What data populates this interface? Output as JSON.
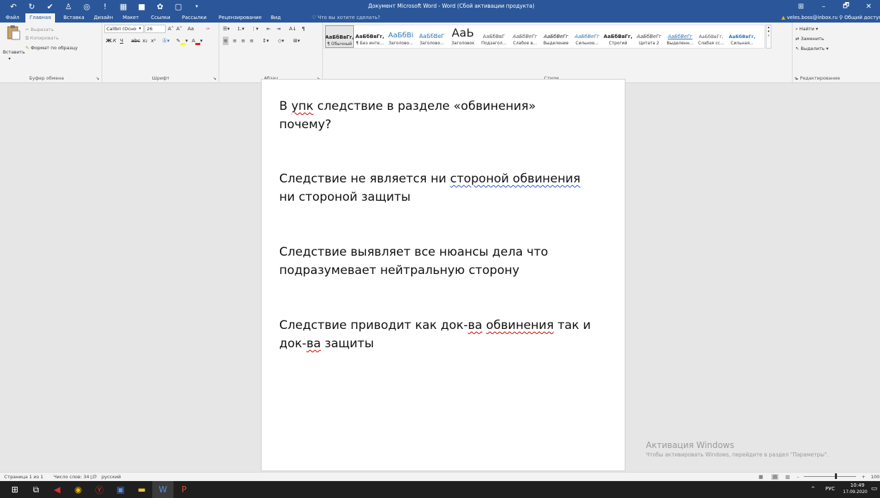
{
  "window": {
    "title": "Документ Microsoft Word - Word (Сбой активации продукта)",
    "qat_icons": [
      "undo-icon",
      "redo-icon",
      "vk-icon",
      "ok-icon",
      "opera-icon",
      "alert-icon",
      "grid-icon",
      "square-icon",
      "bug-icon",
      "new-doc-icon"
    ],
    "controls": [
      "⊞",
      "–",
      "🗗",
      "✕"
    ]
  },
  "tabs": [
    "Файл",
    "Главная",
    "Вставка",
    "Дизайн",
    "Макет",
    "Ссылки",
    "Рассылки",
    "Рецензирование",
    "Вид"
  ],
  "active_tab": "Главная",
  "tell_me": "Что вы хотите сделать?",
  "account": "veles.boss@inbox.ru",
  "share": "Общий доступ",
  "clipboard": {
    "paste": "Вставить",
    "cut": "Вырезать",
    "copy": "Копировать",
    "format_painter": "Формат по образцу",
    "label": "Буфер обмена"
  },
  "font": {
    "name": "Calibri (Осно",
    "size": "26",
    "bold": "Ж",
    "italic": "К",
    "underline": "Ч",
    "strike": "abc",
    "sub": "x₂",
    "sup": "x²",
    "grow": "A˄",
    "shrink": "A˅",
    "case": "Aa",
    "label": "Шрифт"
  },
  "paragraph": {
    "sort": "А↓",
    "pilcrow": "¶",
    "label": "Абзац"
  },
  "styles": {
    "label": "Стили",
    "items": [
      {
        "preview": "АаБбВвГг,",
        "name": "¶ Обычный"
      },
      {
        "preview": "АаБбВвГг,",
        "name": "¶ Без инте..."
      },
      {
        "preview": "АаБбВі",
        "name": "Заголово..."
      },
      {
        "preview": "АаБбВеГ",
        "name": "Заголово..."
      },
      {
        "preview": "АаЬ",
        "name": "Заголовок"
      },
      {
        "preview": "АаБбВвГ",
        "name": "Подзагол..."
      },
      {
        "preview": "АаБбВеГг",
        "name": "Слабое в..."
      },
      {
        "preview": "АаБбВеГг",
        "name": "Выделение"
      },
      {
        "preview": "АаБбВеГг",
        "name": "Сильное..."
      },
      {
        "preview": "АаБбВвГг,",
        "name": "Строгий"
      },
      {
        "preview": "АаБбВеГг",
        "name": "Цитата 2"
      },
      {
        "preview": "АаБбВеГг",
        "name": "Выделенн..."
      },
      {
        "preview": "АаБбВвГг,",
        "name": "Слабая сс..."
      },
      {
        "preview": "АаБбВвГг,",
        "name": "Сильная..."
      }
    ]
  },
  "editing": {
    "find": "Найти",
    "replace": "Заменить",
    "select": "Выделить",
    "label": "Редактирование"
  },
  "document": {
    "p1_a": "В ",
    "p1_err": "упк",
    "p1_b": " следствие в разделе «обвинения»",
    "p1_c": "почему?",
    "p2_a": "Следствие не является ни ",
    "p2_err": "стороной обвинения",
    "p2_b": "ни стороной защиты",
    "p3_a": "Следствие выявляет все нюансы дела что",
    "p3_b": "подразумевает нейтральную сторону",
    "p4_a": "Следствие приводит как док-",
    "p4_err1": "ва",
    "p4_b": " ",
    "p4_err2": "обвинения",
    "p4_c": " так и",
    "p4_d": "док-",
    "p4_err3": "ва",
    "p4_e": " защиты"
  },
  "activation": {
    "title": "Активация Windows",
    "text": "Чтобы активировать Windows, перейдите в раздел \"Параметры\"."
  },
  "status": {
    "page": "Страница 1 из 1",
    "words": "Число слов: 34",
    "lang": "русский",
    "zoom_plus": "+",
    "zoom": "100"
  },
  "taskbar": {
    "lang": "РУС",
    "time": "10:49",
    "date": "17.09.2020"
  }
}
